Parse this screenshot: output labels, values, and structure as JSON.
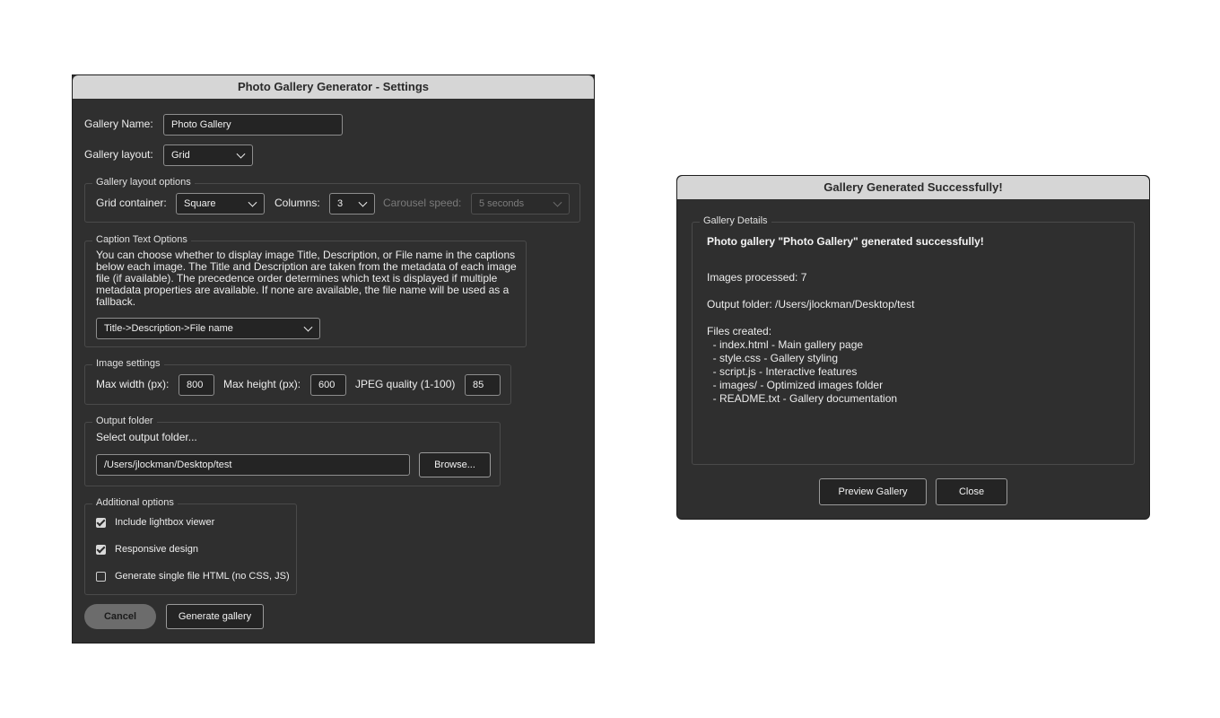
{
  "settings": {
    "title": "Photo Gallery Generator - Settings",
    "gallery_name_label": "Gallery Name:",
    "gallery_name_value": "Photo Gallery",
    "gallery_layout_label": "Gallery layout:",
    "gallery_layout_value": "Grid",
    "layout_options": {
      "legend": "Gallery layout options",
      "grid_container_label": "Grid container:",
      "grid_container_value": "Square",
      "columns_label": "Columns:",
      "columns_value": "3",
      "carousel_speed_label": "Carousel speed:",
      "carousel_speed_value": "5 seconds"
    },
    "caption": {
      "legend": "Caption Text Options",
      "description": "You can choose whether to display image Title, Description, or File name in the captions below each image. The Title and Description are taken from the metadata of each image file (if available). The precedence order determines which text is displayed if multiple metadata properties are available. If none are available, the file name will be used as a fallback.",
      "order_value": "Title->Description->File name"
    },
    "image_settings": {
      "legend": "Image settings",
      "max_width_label": "Max width (px):",
      "max_width_value": "800",
      "max_height_label": "Max height (px):",
      "max_height_value": "600",
      "jpeg_quality_label": "JPEG quality (1-100)",
      "jpeg_quality_value": "85"
    },
    "output": {
      "legend": "Output folder",
      "prompt": "Select output folder...",
      "path_value": "/Users/jlockman/Desktop/test",
      "browse_label": "Browse..."
    },
    "additional": {
      "legend": "Additional options",
      "options": [
        {
          "label": "Include lightbox viewer",
          "checked": true
        },
        {
          "label": "Responsive design",
          "checked": true
        },
        {
          "label": "Generate single file HTML (no CSS, JS)",
          "checked": false
        }
      ]
    },
    "cancel_label": "Cancel",
    "generate_label": "Generate gallery"
  },
  "success": {
    "title": "Gallery Generated Successfully!",
    "legend": "Gallery Details",
    "headline": "Photo gallery \"Photo Gallery\" generated successfully!",
    "images_processed": "Images processed: 7",
    "output_folder": "Output folder: /Users/jlockman/Desktop/test",
    "files_heading": "Files created:",
    "files": [
      "  - index.html - Main gallery page",
      "  - style.css - Gallery styling",
      "  - script.js - Interactive features",
      "  - images/ - Optimized images folder",
      "  - README.txt - Gallery documentation"
    ],
    "preview_label": "Preview Gallery",
    "close_label": "Close"
  }
}
